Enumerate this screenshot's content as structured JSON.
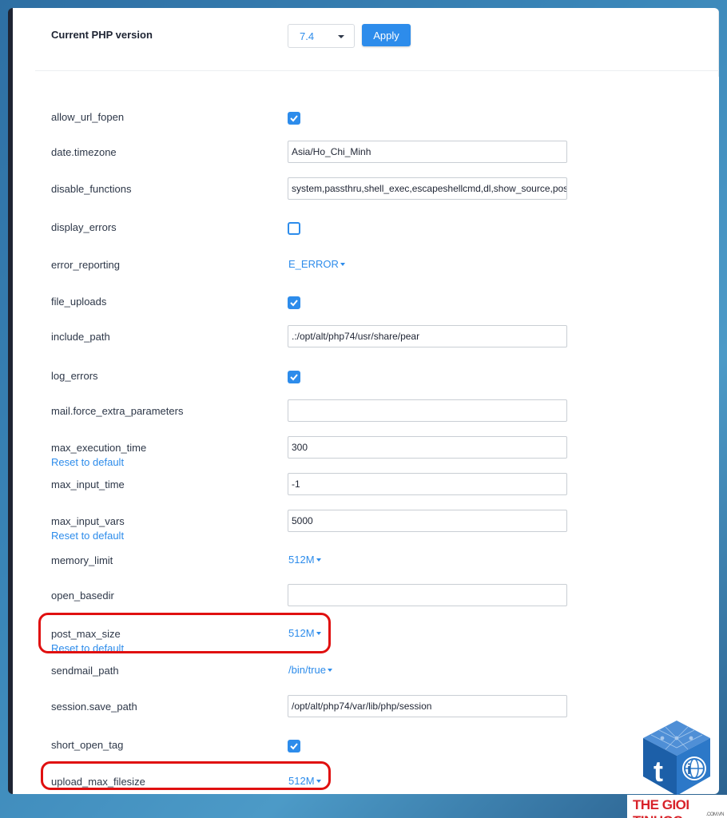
{
  "header": {
    "version_label": "Current PHP version",
    "version_value": "7.4",
    "apply_label": "Apply"
  },
  "settings": [
    {
      "name": "allow_url_fopen",
      "type": "checkbox",
      "checked": true
    },
    {
      "name": "date.timezone",
      "type": "text",
      "value": "Asia/Ho_Chi_Minh"
    },
    {
      "name": "disable_functions",
      "type": "text",
      "value": "system,passthru,shell_exec,escapeshellcmd,dl,show_source,posi"
    },
    {
      "name": "display_errors",
      "type": "checkbox",
      "checked": false
    },
    {
      "name": "error_reporting",
      "type": "dropdown",
      "value": "E_ERROR"
    },
    {
      "name": "file_uploads",
      "type": "checkbox",
      "checked": true
    },
    {
      "name": "include_path",
      "type": "text",
      "value": ".:/opt/alt/php74/usr/share/pear"
    },
    {
      "name": "log_errors",
      "type": "checkbox",
      "checked": true
    },
    {
      "name": "mail.force_extra_parameters",
      "type": "text",
      "value": ""
    },
    {
      "name": "max_execution_time",
      "type": "text",
      "value": "300",
      "reset": "Reset to default"
    },
    {
      "name": "max_input_time",
      "type": "text",
      "value": "-1"
    },
    {
      "name": "max_input_vars",
      "type": "text",
      "value": "5000",
      "reset": "Reset to default"
    },
    {
      "name": "memory_limit",
      "type": "dropdown",
      "value": "512M"
    },
    {
      "name": "open_basedir",
      "type": "text",
      "value": ""
    },
    {
      "name": "post_max_size",
      "type": "dropdown",
      "value": "512M",
      "reset": "Reset to default"
    },
    {
      "name": "sendmail_path",
      "type": "dropdown",
      "value": "/bin/true"
    },
    {
      "name": "session.save_path",
      "type": "text",
      "value": "/opt/alt/php74/var/lib/php/session"
    },
    {
      "name": "short_open_tag",
      "type": "checkbox",
      "checked": true
    },
    {
      "name": "upload_max_filesize",
      "type": "dropdown",
      "value": "512M"
    }
  ],
  "watermark": {
    "text": "THE GIOI TINHOC",
    "subtext": ".COM.VN"
  },
  "colors": {
    "accent": "#2d8ceb",
    "highlight": "#e01010",
    "brand_red": "#d8232a",
    "logo_blue": "#1c5fa8"
  }
}
